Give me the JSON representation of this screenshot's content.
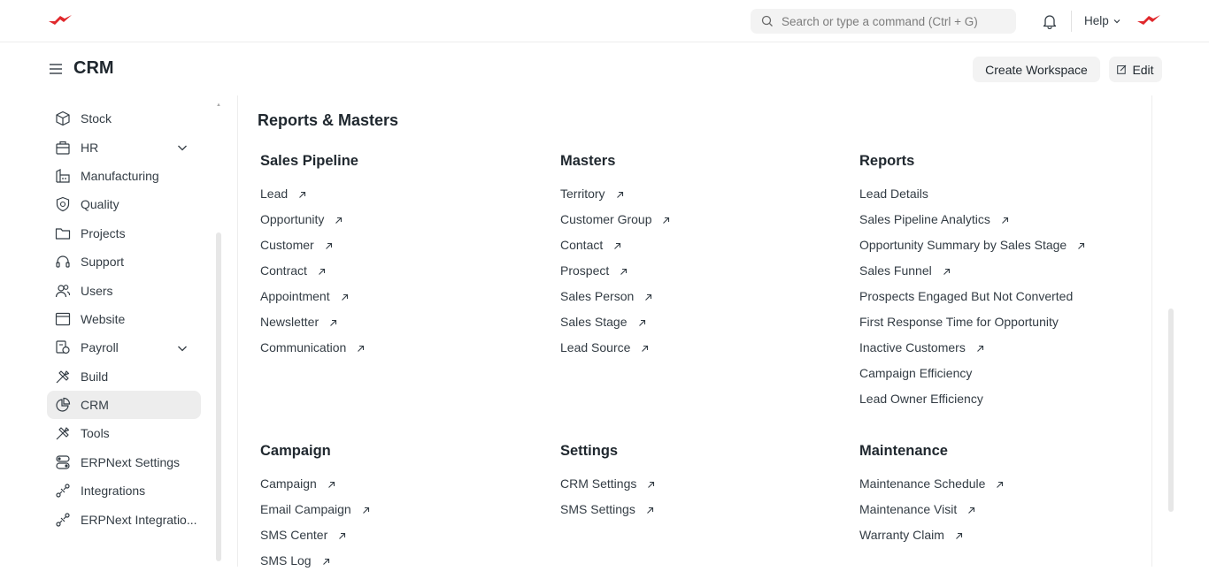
{
  "navbar": {
    "search_placeholder": "Search or type a command (Ctrl + G)",
    "help_label": "Help"
  },
  "header": {
    "title": "CRM",
    "create_workspace_label": "Create Workspace",
    "edit_label": "Edit"
  },
  "sidebar": {
    "items": [
      {
        "label": "Stock",
        "icon": "box-icon"
      },
      {
        "label": "HR",
        "icon": "briefcase-icon"
      },
      {
        "label": "Manufacturing",
        "icon": "factory-icon"
      },
      {
        "label": "Quality",
        "icon": "shield-icon"
      },
      {
        "label": "Projects",
        "icon": "folder-icon"
      },
      {
        "label": "Support",
        "icon": "headset-icon"
      },
      {
        "label": "Users",
        "icon": "users-icon"
      },
      {
        "label": "Website",
        "icon": "browser-icon"
      },
      {
        "label": "Payroll",
        "icon": "payroll-icon"
      },
      {
        "label": "Build",
        "icon": "tools-icon"
      },
      {
        "label": "CRM",
        "icon": "pie-chart-icon"
      },
      {
        "label": "Tools",
        "icon": "tools-icon"
      },
      {
        "label": "ERPNext Settings",
        "icon": "toggles-icon"
      },
      {
        "label": "Integrations",
        "icon": "integration-icon"
      },
      {
        "label": "ERPNext Integratio...",
        "icon": "integration-icon"
      }
    ]
  },
  "main": {
    "section_title": "Reports & Masters",
    "cards": [
      {
        "title": "Sales Pipeline",
        "links": [
          {
            "label": "Lead",
            "arrow": true
          },
          {
            "label": "Opportunity",
            "arrow": true
          },
          {
            "label": "Customer",
            "arrow": true
          },
          {
            "label": "Contract",
            "arrow": true
          },
          {
            "label": "Appointment",
            "arrow": true
          },
          {
            "label": "Newsletter",
            "arrow": true
          },
          {
            "label": "Communication",
            "arrow": true
          }
        ]
      },
      {
        "title": "Masters",
        "links": [
          {
            "label": "Territory",
            "arrow": true
          },
          {
            "label": "Customer Group",
            "arrow": true
          },
          {
            "label": "Contact",
            "arrow": true
          },
          {
            "label": "Prospect",
            "arrow": true
          },
          {
            "label": "Sales Person",
            "arrow": true
          },
          {
            "label": "Sales Stage",
            "arrow": true
          },
          {
            "label": "Lead Source",
            "arrow": true
          }
        ]
      },
      {
        "title": "Reports",
        "links": [
          {
            "label": "Lead Details",
            "arrow": false
          },
          {
            "label": "Sales Pipeline Analytics",
            "arrow": true
          },
          {
            "label": "Opportunity Summary by Sales Stage",
            "arrow": true
          },
          {
            "label": "Sales Funnel",
            "arrow": true
          },
          {
            "label": "Prospects Engaged But Not Converted",
            "arrow": false
          },
          {
            "label": "First Response Time for Opportunity",
            "arrow": false
          },
          {
            "label": "Inactive Customers",
            "arrow": true
          },
          {
            "label": "Campaign Efficiency",
            "arrow": false
          },
          {
            "label": "Lead Owner Efficiency",
            "arrow": false
          }
        ]
      },
      {
        "title": "Campaign",
        "links": [
          {
            "label": "Campaign",
            "arrow": true
          },
          {
            "label": "Email Campaign",
            "arrow": true
          },
          {
            "label": "SMS Center",
            "arrow": true
          },
          {
            "label": "SMS Log",
            "arrow": true
          }
        ]
      },
      {
        "title": "Settings",
        "links": [
          {
            "label": "CRM Settings",
            "arrow": true
          },
          {
            "label": "SMS Settings",
            "arrow": true
          }
        ]
      },
      {
        "title": "Maintenance",
        "links": [
          {
            "label": "Maintenance Schedule",
            "arrow": true
          },
          {
            "label": "Maintenance Visit",
            "arrow": true
          },
          {
            "label": "Warranty Claim",
            "arrow": true
          }
        ]
      }
    ]
  },
  "colors": {
    "brand": "#e0282c",
    "active_bg": "#ededed",
    "text": "#333c44"
  }
}
